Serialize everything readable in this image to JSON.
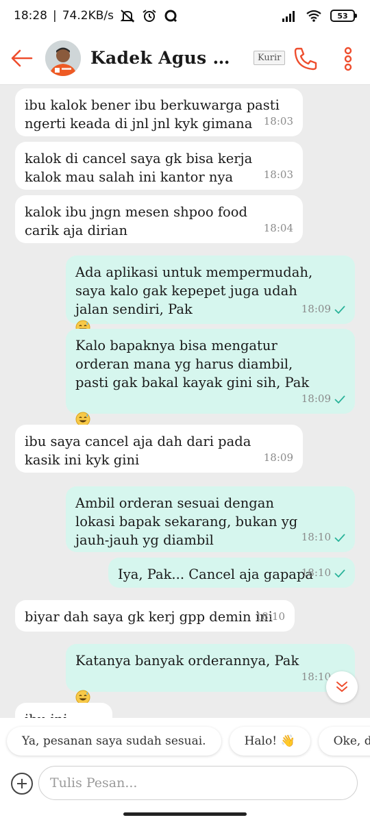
{
  "status_bar": {
    "time": "18:28",
    "speed": "74.2KB/s",
    "battery": "53",
    "icons": [
      "mute-icon",
      "alarm-icon",
      "q-app-icon",
      "signal-icon",
      "wifi-icon",
      "battery-icon"
    ]
  },
  "header": {
    "back_icon": "arrow-left-icon",
    "contact_name": "Kadek Agus Widi...",
    "role_badge": "Kurir",
    "call_icon": "phone-icon",
    "more_icon": "more-vertical-icon",
    "accent_color": "#ee4d2d"
  },
  "messages": [
    {
      "dir": "in",
      "text": "ibu kalok bener ibu berkuwarga pasti\nngerti keada di jnl jnl kyk gimana",
      "time": "18:03"
    },
    {
      "dir": "in",
      "text": "kalok di cancel saya gk bisa kerja\nkalok mau salah ini kantor nya",
      "time": "18:03"
    },
    {
      "dir": "in",
      "text": "kalok ibu jngn mesen shpoo food\ncarik aja dirian",
      "time": "18:04"
    },
    {
      "dir": "out",
      "text": "Ada aplikasi untuk mempermudah,\nsaya kalo gak kepepet juga udah\njalan sendiri, Pak",
      "emoji": "sweat-smile-emoji",
      "time": "18:09",
      "read": true
    },
    {
      "dir": "out",
      "text": "Kalo bapaknya bisa mengatur\norderan mana yg harus diambil,\npasti gak bakal kayak gini sih, Pak",
      "emoji": "sweat-smile-emoji",
      "time": "18:09",
      "read": true
    },
    {
      "dir": "in",
      "text": "ibu saya cancel aja dah dari pada\nkasik ini kyk gini",
      "time": "18:09"
    },
    {
      "dir": "out",
      "text": "Ambil orderan sesuai dengan\nlokasi bapak sekarang, bukan yg\njauh-jauh yg diambil",
      "time": "18:10",
      "read": true
    },
    {
      "dir": "out",
      "text": "Iya, Pak... Cancel aja gapapa",
      "time": "18:10",
      "read": true
    },
    {
      "dir": "in",
      "text": "biyar dah saya gk kerj gpp demin ini",
      "time": "18:10"
    },
    {
      "dir": "out",
      "text": "Katanya banyak orderannya, Pak",
      "emoji": "sweat-smile-emoji",
      "time": "18:10",
      "read": true
    },
    {
      "dir": "in",
      "text": "ibu ini",
      "time": ""
    }
  ],
  "scroll_down_icon": "chevron-double-down-icon",
  "quick_replies": [
    "Ya, pesanan saya sudah sesuai.",
    "Halo! 👋",
    "Oke, ditunggu ya"
  ],
  "composer": {
    "add_icon": "plus-circle-icon",
    "placeholder": "Tulis Pesan..."
  }
}
